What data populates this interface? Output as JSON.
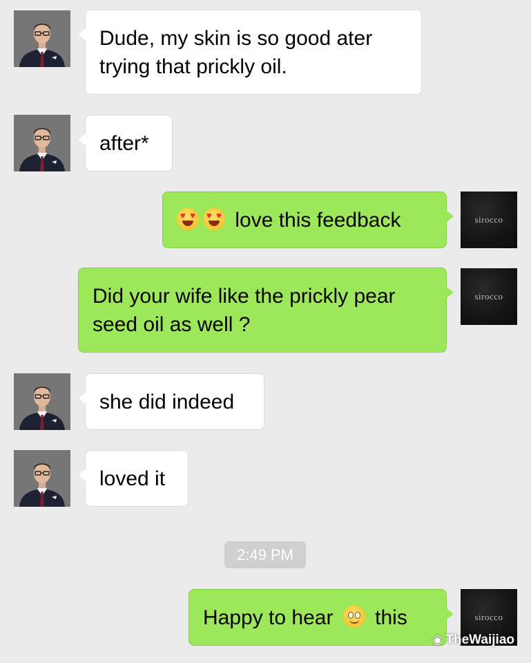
{
  "contact": {
    "avatar_icon": "businessman-portrait-icon"
  },
  "self": {
    "avatar_label": "sirocco"
  },
  "messages": [
    {
      "from": "contact",
      "lines": [
        "Dude, my skin is so good ater",
        "trying that prickly oil."
      ]
    },
    {
      "from": "contact",
      "lines": [
        "after*"
      ]
    },
    {
      "from": "self",
      "emojis": [
        "heart-eyes-emoji",
        "heart-eyes-emoji"
      ],
      "text": "love this feedback"
    },
    {
      "from": "self",
      "lines": [
        "Did your wife like the prickly pear",
        "seed oil as well ?"
      ]
    },
    {
      "from": "contact",
      "lines": [
        "she did indeed"
      ]
    },
    {
      "from": "contact",
      "lines": [
        "loved it"
      ]
    },
    {
      "from": "self",
      "text_before": "Happy to hear",
      "emoji": "smiling-face-emoji",
      "text_after": "this"
    }
  ],
  "timestamp": "2:49 PM",
  "watermark": "TheWaijiao",
  "colors": {
    "background": "#ebebeb",
    "incoming_bubble": "#ffffff",
    "outgoing_bubble": "#9de85a"
  }
}
